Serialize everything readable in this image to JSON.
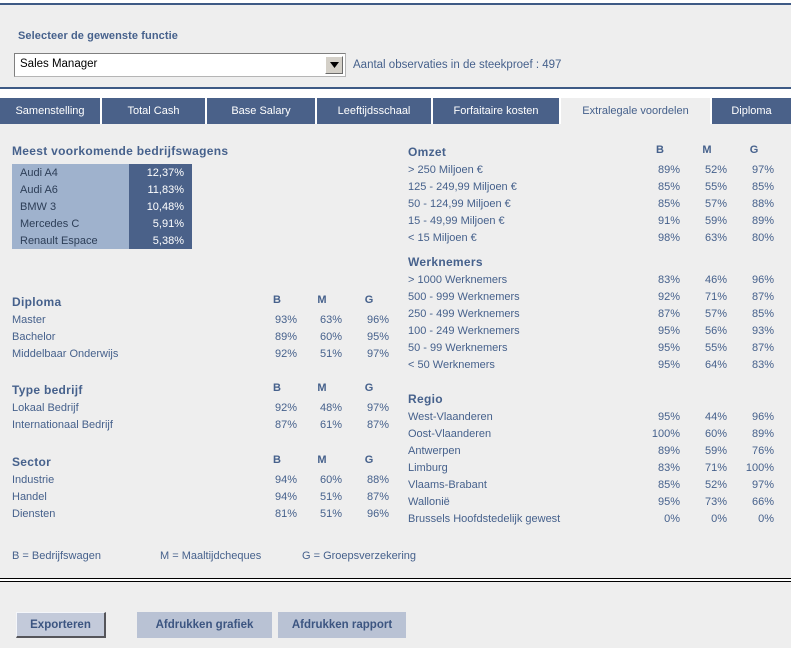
{
  "selector": {
    "label": "Selecteer de gewenste functie",
    "value": "Sales Manager",
    "placeholder": "Sales Manager",
    "arrow_icon": "chevron-down-icon",
    "observations_text": "Aantal observaties in de steekproef :  497",
    "observations_count": "497"
  },
  "tabs": [
    {
      "label": "Samenstelling",
      "active": false,
      "width": 102
    },
    {
      "label": "Total Cash",
      "active": false,
      "width": 105
    },
    {
      "label": "Base Salary",
      "active": false,
      "width": 110
    },
    {
      "label": "Leeftijdsschaal",
      "active": false,
      "width": 116
    },
    {
      "label": "Forfaitaire kosten",
      "active": false,
      "width": 128
    },
    {
      "label": "Extralegale voordelen",
      "active": true,
      "width": 151
    },
    {
      "label": "Diploma",
      "active": false,
      "width": 79
    }
  ],
  "cars": {
    "title": "Meest voorkomende bedrijfswagens",
    "rows": [
      {
        "name": "Audi A4",
        "pct": "12,37%"
      },
      {
        "name": "Audi A6",
        "pct": "11,83%"
      },
      {
        "name": "BMW 3",
        "pct": "10,48%"
      },
      {
        "name": "Mercedes C",
        "pct": "5,91%"
      },
      {
        "name": "Renault Espace",
        "pct": "5,38%"
      }
    ]
  },
  "columns": {
    "b": "B",
    "m": "M",
    "g": "G"
  },
  "blocks_left": [
    {
      "title": "Diploma",
      "rows": [
        {
          "label": "Master",
          "b": "93%",
          "m": "63%",
          "g": "96%"
        },
        {
          "label": "Bachelor",
          "b": "89%",
          "m": "60%",
          "g": "95%"
        },
        {
          "label": "Middelbaar Onderwijs",
          "b": "92%",
          "m": "51%",
          "g": "97%"
        }
      ]
    },
    {
      "title": "Type bedrijf",
      "rows": [
        {
          "label": "Lokaal Bedrijf",
          "b": "92%",
          "m": "48%",
          "g": "97%"
        },
        {
          "label": "Internationaal Bedrijf",
          "b": "87%",
          "m": "61%",
          "g": "87%"
        }
      ]
    },
    {
      "title": "Sector",
      "rows": [
        {
          "label": "Industrie",
          "b": "94%",
          "m": "60%",
          "g": "88%"
        },
        {
          "label": "Handel",
          "b": "94%",
          "m": "51%",
          "g": "87%"
        },
        {
          "label": "Diensten",
          "b": "81%",
          "m": "51%",
          "g": "96%"
        }
      ]
    }
  ],
  "blocks_right": [
    {
      "title": "Omzet",
      "show_heads": true,
      "rows": [
        {
          "label": "> 250 Miljoen €",
          "b": "89%",
          "m": "52%",
          "g": "97%"
        },
        {
          "label": "125 - 249,99 Miljoen €",
          "b": "85%",
          "m": "55%",
          "g": "85%"
        },
        {
          "label": "50 - 124,99 Miljoen €",
          "b": "85%",
          "m": "57%",
          "g": "88%"
        },
        {
          "label": "15 - 49,99 Miljoen €",
          "b": "91%",
          "m": "59%",
          "g": "89%"
        },
        {
          "label": "< 15 Miljoen €",
          "b": "98%",
          "m": "63%",
          "g": "80%"
        }
      ]
    },
    {
      "title": "Werknemers",
      "show_heads": false,
      "rows": [
        {
          "label": "> 1000 Werknemers",
          "b": "83%",
          "m": "46%",
          "g": "96%"
        },
        {
          "label": "500 - 999 Werknemers",
          "b": "92%",
          "m": "71%",
          "g": "87%"
        },
        {
          "label": "250 - 499 Werknemers",
          "b": "87%",
          "m": "57%",
          "g": "85%"
        },
        {
          "label": "100 - 249 Werknemers",
          "b": "95%",
          "m": "56%",
          "g": "93%"
        },
        {
          "label": "50 - 99 Werknemers",
          "b": "95%",
          "m": "55%",
          "g": "87%"
        },
        {
          "label": "< 50 Werknemers",
          "b": "95%",
          "m": "64%",
          "g": "83%"
        }
      ]
    },
    {
      "title": "Regio",
      "show_heads": false,
      "rows": [
        {
          "label": "West-Vlaanderen",
          "b": "95%",
          "m": "44%",
          "g": "96%"
        },
        {
          "label": "Oost-Vlaanderen",
          "b": "100%",
          "m": "60%",
          "g": "89%"
        },
        {
          "label": "Antwerpen",
          "b": "89%",
          "m": "59%",
          "g": "76%"
        },
        {
          "label": "Limburg",
          "b": "83%",
          "m": "71%",
          "g": "100%"
        },
        {
          "label": "Vlaams-Brabant",
          "b": "85%",
          "m": "52%",
          "g": "97%"
        },
        {
          "label": "Wallonië",
          "b": "95%",
          "m": "73%",
          "g": "66%"
        },
        {
          "label": "Brussels Hoofdstedelijk gewest",
          "b": "0%",
          "m": "0%",
          "g": "0%"
        }
      ]
    }
  ],
  "legend": [
    "B = Bedrijfswagen",
    "M = Maaltijdcheques",
    "G = Groepsverzekering"
  ],
  "buttons": {
    "export": "Exporteren",
    "print_chart": "Afdrukken grafiek",
    "print_report": "Afdrukken rapport"
  },
  "colors": {
    "tab_blue": "#4a6189",
    "text_blue": "#46618c",
    "panel_bg": "#eeeeee",
    "car_light": "#9fb2cd",
    "car_dark": "#4a6189",
    "button_bg": "#b9c2d4"
  }
}
